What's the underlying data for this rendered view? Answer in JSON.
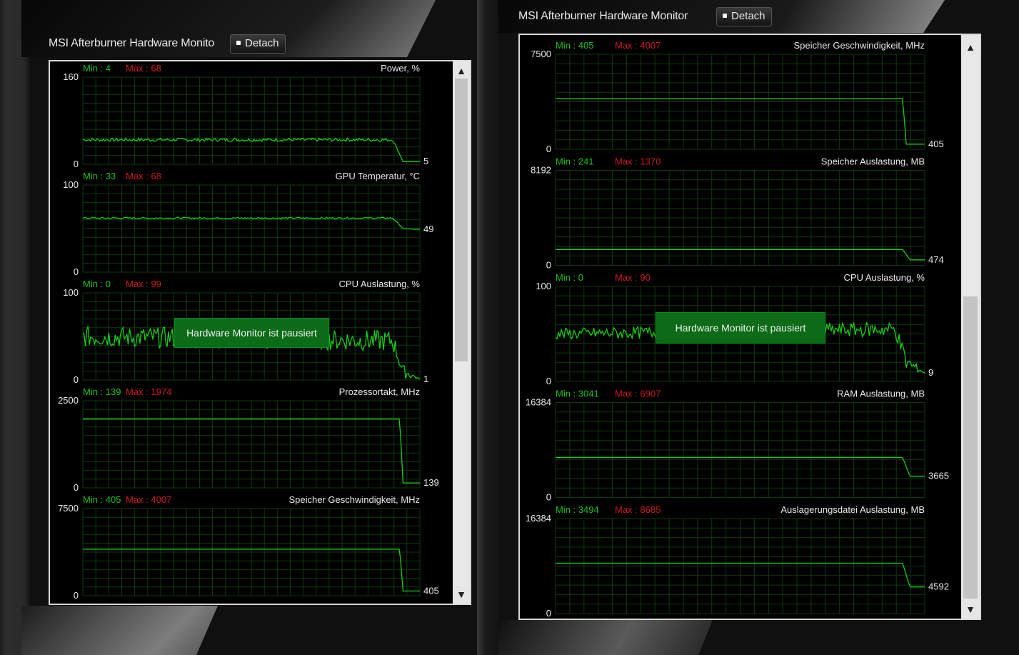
{
  "colors": {
    "graph_line": "#16d016",
    "grid": "#0d3a0d",
    "min_text": "#1fbf1f",
    "max_text": "#cc1c1c",
    "pause_bg": "#0c6b16"
  },
  "window_left": {
    "title": "MSI Afterburner Hardware Monito",
    "detach_label": "Detach",
    "pause_label": "Hardware Monitor ist pausiert",
    "graphs": [
      {
        "name": "Power, %",
        "min_label": "Min : 4",
        "max_label": "Max : 68",
        "axis_top": "160",
        "axis_bottom": "0",
        "current": "5",
        "ymax": 160,
        "samples": [
          [
            0,
            45,
            3
          ],
          [
            0.92,
            45,
            3
          ],
          [
            0.95,
            5,
            0
          ],
          [
            1,
            5,
            0
          ]
        ],
        "paused": false
      },
      {
        "name": "GPU Temperatur, °C",
        "min_label": "Min : 33",
        "max_label": "Max : 68",
        "axis_top": "100",
        "axis_bottom": "0",
        "current": "49",
        "ymax": 100,
        "samples": [
          [
            0,
            62,
            1
          ],
          [
            0.92,
            62,
            1
          ],
          [
            0.95,
            50,
            0
          ],
          [
            1,
            49,
            0
          ]
        ],
        "paused": false
      },
      {
        "name": "CPU Auslastung, %",
        "min_label": "Min : 0",
        "max_label": "Max : 99",
        "axis_top": "100",
        "axis_bottom": "0",
        "current": "1",
        "ymax": 100,
        "samples": [
          [
            0,
            50,
            12
          ],
          [
            0.92,
            45,
            12
          ],
          [
            0.95,
            10,
            8
          ],
          [
            1,
            1,
            0
          ]
        ],
        "paused": true
      },
      {
        "name": "Prozessortakt, MHz",
        "min_label": "Min : 139",
        "max_label": "Max : 1974",
        "axis_top": "2500",
        "axis_bottom": "0",
        "current": "139",
        "ymax": 2500,
        "samples": [
          [
            0,
            1974,
            0
          ],
          [
            0.94,
            1974,
            0
          ],
          [
            0.95,
            139,
            0
          ],
          [
            1,
            139,
            0
          ]
        ],
        "paused": false
      },
      {
        "name": "Speicher Geschwindigkeit, MHz",
        "min_label": "Min : 405",
        "max_label": "Max : 4007",
        "axis_top": "7500",
        "axis_bottom": "0",
        "current": "405",
        "ymax": 7500,
        "samples": [
          [
            0,
            4007,
            0
          ],
          [
            0.94,
            4007,
            0
          ],
          [
            0.95,
            405,
            0
          ],
          [
            1,
            405,
            0
          ]
        ],
        "paused": false
      }
    ]
  },
  "window_right": {
    "title": "MSI Afterburner Hardware Monitor",
    "detach_label": "Detach",
    "pause_label": "Hardware Monitor ist pausiert",
    "graphs": [
      {
        "name": "Speicher Geschwindigkeit, MHz",
        "min_label": "Min : 405",
        "max_label": "Max : 4007",
        "axis_top": "7500",
        "axis_bottom": "0",
        "current": "405",
        "ymax": 7500,
        "samples": [
          [
            0,
            4007,
            0
          ],
          [
            0.94,
            4007,
            0
          ],
          [
            0.95,
            405,
            0
          ],
          [
            1,
            405,
            0
          ]
        ],
        "paused": false
      },
      {
        "name": "Speicher Auslastung, MB",
        "min_label": "Min : 241",
        "max_label": "Max : 1370",
        "axis_top": "8192",
        "axis_bottom": "0",
        "current": "474",
        "ymax": 8192,
        "samples": [
          [
            0,
            1370,
            0
          ],
          [
            0.94,
            1370,
            0
          ],
          [
            0.96,
            474,
            0
          ],
          [
            1,
            474,
            0
          ]
        ],
        "paused": false
      },
      {
        "name": "CPU Auslastung, %",
        "min_label": "Min : 0",
        "max_label": "Max : 90",
        "axis_top": "100",
        "axis_bottom": "0",
        "current": "9",
        "ymax": 100,
        "samples": [
          [
            0,
            50,
            6
          ],
          [
            0.92,
            55,
            8
          ],
          [
            0.95,
            20,
            10
          ],
          [
            1,
            9,
            0
          ]
        ],
        "paused": true
      },
      {
        "name": "RAM Auslastung, MB",
        "min_label": "Min : 3041",
        "max_label": "Max : 6907",
        "axis_top": "16384",
        "axis_bottom": "0",
        "current": "3665",
        "ymax": 16384,
        "samples": [
          [
            0,
            6907,
            0
          ],
          [
            0.94,
            6907,
            0
          ],
          [
            0.96,
            3665,
            0
          ],
          [
            1,
            3665,
            0
          ]
        ],
        "paused": false
      },
      {
        "name": "Auslagerungsdatei Auslastung, MB",
        "min_label": "Min : 3494",
        "max_label": "Max : 8685",
        "axis_top": "16384",
        "axis_bottom": "0",
        "current": "4592",
        "ymax": 16384,
        "samples": [
          [
            0,
            8685,
            0
          ],
          [
            0.94,
            8685,
            0
          ],
          [
            0.96,
            4592,
            0
          ],
          [
            1,
            4592,
            0
          ]
        ],
        "paused": false
      }
    ]
  }
}
